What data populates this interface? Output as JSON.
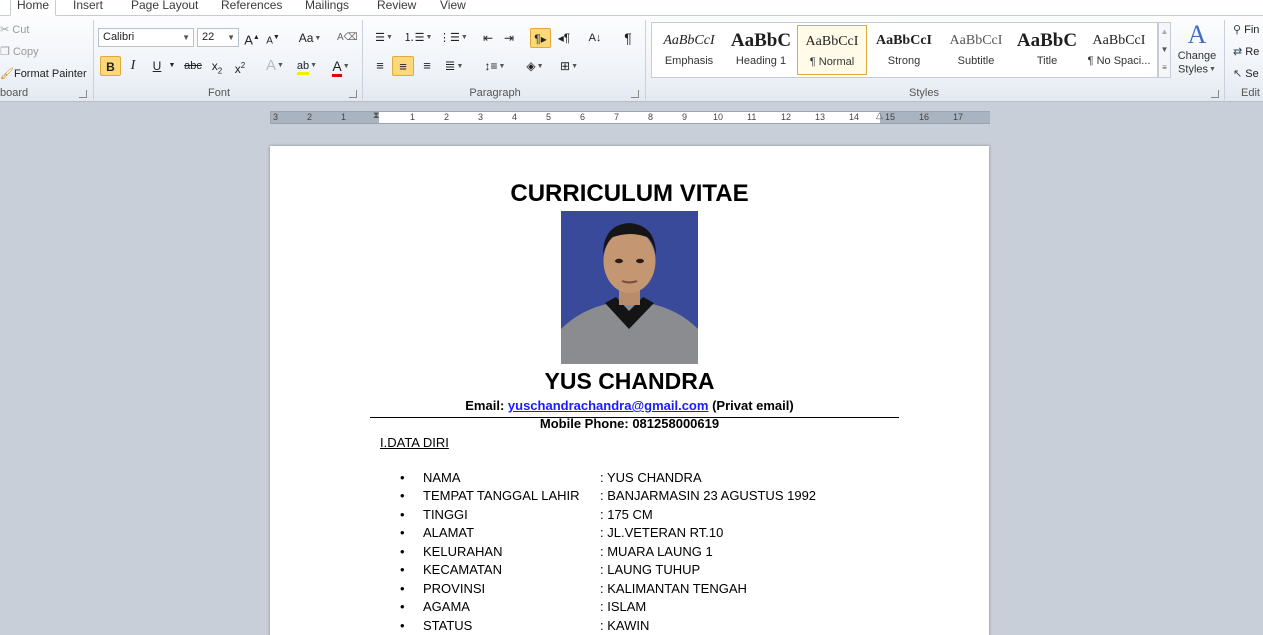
{
  "tabs": [
    "Home",
    "Insert",
    "Page Layout",
    "References",
    "Mailings",
    "Review",
    "View"
  ],
  "clipboard": {
    "cut": "Cut",
    "copy": "Copy",
    "format_painter": "Format Painter",
    "group_label": "board"
  },
  "font": {
    "name": "Calibri",
    "size": "22",
    "group_label": "Font"
  },
  "paragraph": {
    "group_label": "Paragraph"
  },
  "styles": {
    "group_label": "Styles",
    "items": [
      {
        "preview": "AaBbCcI",
        "name": "Emphasis"
      },
      {
        "preview": "AaBbC",
        "name": "Heading 1"
      },
      {
        "preview": "AaBbCcI",
        "name": "¶ Normal"
      },
      {
        "preview": "AaBbCcI",
        "name": "Strong"
      },
      {
        "preview": "AaBbCcI",
        "name": "Subtitle"
      },
      {
        "preview": "AaBbC",
        "name": "Title"
      },
      {
        "preview": "AaBbCcI",
        "name": "¶ No Spaci..."
      }
    ],
    "change_styles_line1": "Change",
    "change_styles_line2": "Styles"
  },
  "editing": {
    "find": "Fin",
    "replace": "Re",
    "select": "Se",
    "group_label": "Edit"
  },
  "ruler": [
    "3",
    "2",
    "1",
    "1",
    "2",
    "3",
    "4",
    "5",
    "6",
    "7",
    "8",
    "9",
    "10",
    "11",
    "12",
    "13",
    "14",
    "15",
    "16",
    "17"
  ],
  "document": {
    "title": "CURRICULUM VITAE",
    "name": "YUS CHANDRA",
    "email_label": "Email:",
    "email": "yuschandrachandra@gmail.com",
    "email_note": "(Privat email)",
    "phone": "Mobile Phone: 081258000619",
    "section": "I.DATA DIRI",
    "fields": [
      {
        "label": "NAMA",
        "value": ": YUS CHANDRA"
      },
      {
        "label": "TEMPAT TANGGAL LAHIR",
        "value": ": BANJARMASIN 23 AGUSTUS 1992"
      },
      {
        "label": "TINGGI",
        "value": ": 175  CM"
      },
      {
        "label": "ALAMAT",
        "value": ": JL.VETERAN RT.10"
      },
      {
        "label": "KELURAHAN",
        "value": ": MUARA LAUNG 1"
      },
      {
        "label": "KECAMATAN",
        "value": ": LAUNG TUHUP"
      },
      {
        "label": "PROVINSI",
        "value": ": KALIMANTAN TENGAH"
      },
      {
        "label": "AGAMA",
        "value": ": ISLAM"
      },
      {
        "label": "STATUS",
        "value": ": KAWIN"
      }
    ]
  }
}
